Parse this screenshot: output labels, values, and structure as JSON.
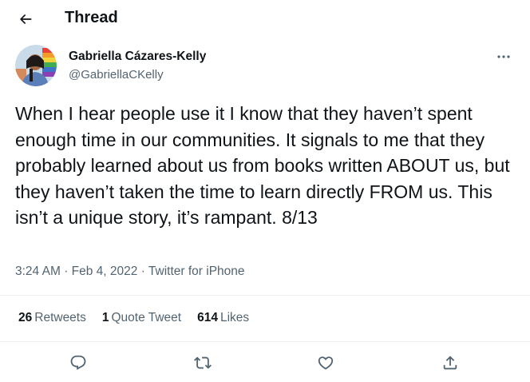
{
  "header": {
    "title": "Thread",
    "back_icon": "arrow-left-icon"
  },
  "author": {
    "display_name": "Gabriella Cázares-Kelly",
    "handle": "@GabriellaCKelly",
    "avatar_icon": "avatar-photo"
  },
  "tweet": {
    "text": "When I hear people use it I know that they haven’t spent enough time in our communities. It signals to me that they probably learned about us from books written ABOUT us, but they haven’t taken the time to learn directly FROM us. This isn’t a unique story, it’s rampant. 8/13"
  },
  "meta": {
    "time": "3:24 AM",
    "separator": "·",
    "date": "Feb 4, 2022",
    "source": "Twitter for iPhone"
  },
  "stats": {
    "retweets_count": "26",
    "retweets_label": "Retweets",
    "quotes_count": "1",
    "quotes_label": "Quote Tweet",
    "likes_count": "614",
    "likes_label": "Likes"
  },
  "actions": {
    "reply_icon": "reply-icon",
    "retweet_icon": "retweet-icon",
    "like_icon": "heart-icon",
    "share_icon": "share-icon"
  },
  "colors": {
    "text_primary": "#0f1419",
    "text_secondary": "#536471",
    "divider": "#eff3f4"
  }
}
